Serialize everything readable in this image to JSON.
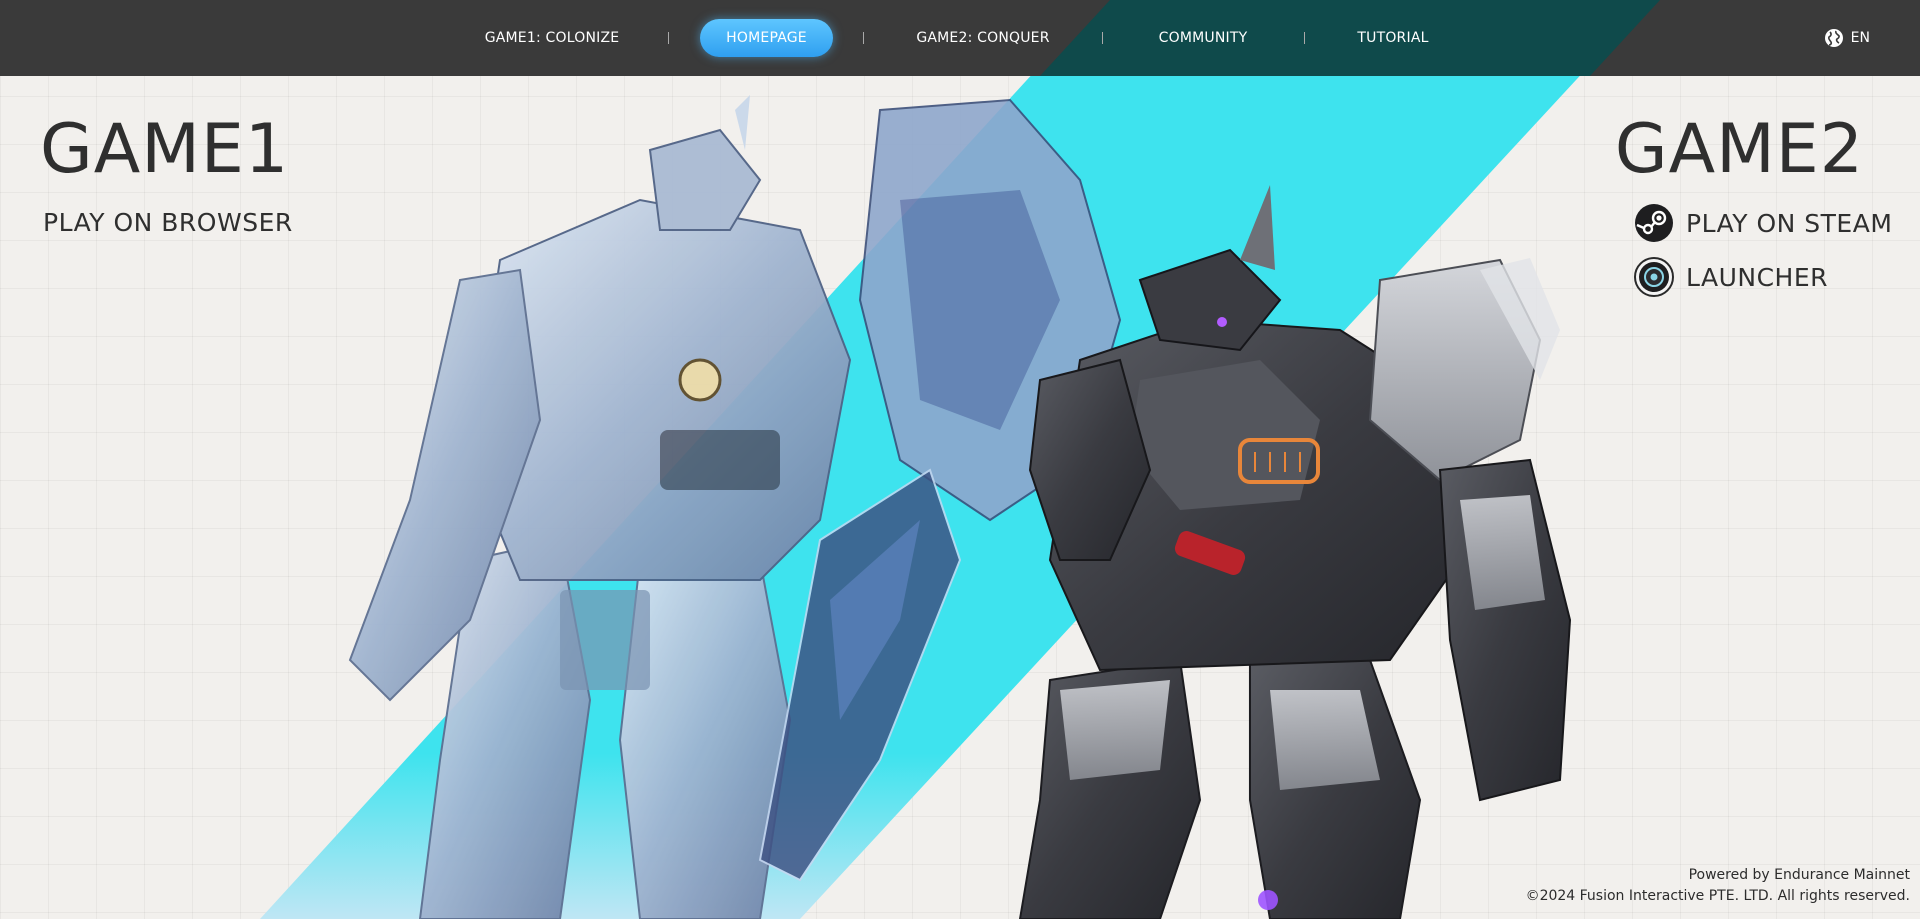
{
  "colors": {
    "accent_cyan": "#3ee3ee",
    "nav_bg": "#3a3a3a",
    "nav_teal": "#0f4a4b",
    "active_pill": "#3aaaf5",
    "text_dark": "#2f2f2f"
  },
  "nav": {
    "items": [
      {
        "label": "GAME1: COLONIZE",
        "active": false
      },
      {
        "label": "HOMEPAGE",
        "active": true
      },
      {
        "label": "GAME2: CONQUER",
        "active": false
      },
      {
        "label": "COMMUNITY",
        "active": false
      },
      {
        "label": "TUTORIAL",
        "active": false
      }
    ],
    "language": {
      "icon": "globe-icon",
      "label": "EN"
    }
  },
  "game1": {
    "title": "GAME1",
    "action": "PLAY ON BROWSER"
  },
  "game2": {
    "title": "GAME2",
    "actions": [
      {
        "icon": "steam-icon",
        "label": "PLAY ON STEAM"
      },
      {
        "icon": "launcher-icon",
        "label": "LAUNCHER"
      }
    ]
  },
  "footer": {
    "powered_by": "Powered by Endurance Mainnet",
    "copyright": "©2024 Fusion Interactive PTE. LTD. All rights reserved."
  }
}
